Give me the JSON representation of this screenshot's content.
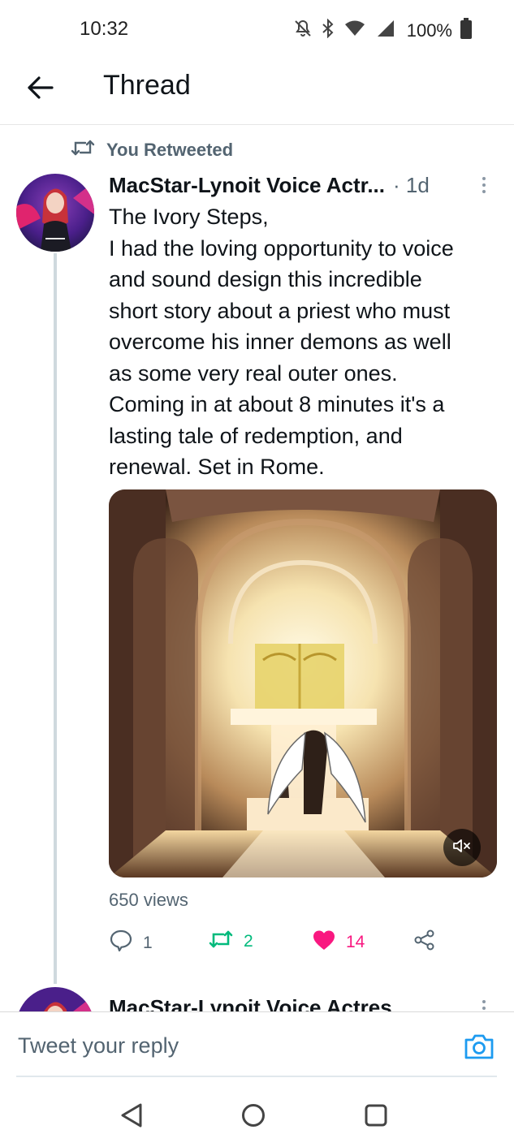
{
  "status_bar": {
    "time": "10:32",
    "battery_text": "100%",
    "icons": [
      "mute-icon",
      "bluetooth-icon",
      "wifi-icon",
      "signal-icon",
      "battery-icon"
    ]
  },
  "header": {
    "title": "Thread",
    "back_icon": "back-arrow-icon"
  },
  "retweet_context": {
    "label": "You Retweeted"
  },
  "tweet": {
    "author_name": "MacStar-Lynoit Voice Actr...",
    "time": "· 1d",
    "body_lines": [
      "The Ivory Steps,",
      "I had the loving opportunity to voice",
      "and sound design this incredible",
      "short story about a priest who must",
      "overcome his inner demons as well",
      "as some very real outer ones.",
      "Coming in at about 8 minutes it's a",
      "lasting tale of redemption, and",
      "renewal. Set in Rome."
    ],
    "media_icon": "mute-speaker-icon",
    "views": "650 views",
    "actions": {
      "reply_count": "1",
      "retweet_count": "2",
      "like_count": "14"
    },
    "colors": {
      "retweet": "#00ba7c",
      "like": "#f91880",
      "secondary_text": "#536471"
    }
  },
  "next_tweet": {
    "author_name": "MacStar-Lynoit Voice Actres"
  },
  "reply_bar": {
    "placeholder": "Tweet your reply",
    "camera_icon": "camera-icon"
  },
  "nav_bar": {
    "icons": [
      "nav-back-icon",
      "nav-home-icon",
      "nav-recents-icon"
    ]
  }
}
